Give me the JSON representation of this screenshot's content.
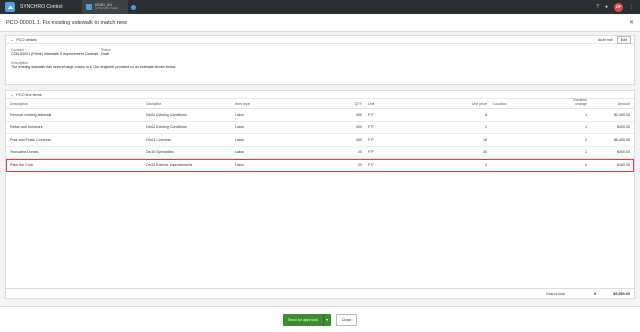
{
  "app": {
    "title": "SYNCHRO Control",
    "project_line1": "DEMO_001",
    "project_line2": "SYNCHRO Dash",
    "avatar_initials": "DP"
  },
  "page": {
    "title": "PCO-00001.1: Fix existing sidewalk to match new"
  },
  "details": {
    "section_title": "PCO details",
    "audit_trail": "Audit trail",
    "edit_label": "Edit",
    "contract_label": "Contract",
    "contract_value": "CON-00001 (Prime) Interstate 5 improvement Contract",
    "status_label": "Status",
    "status_value": "Draft",
    "description_label": "Description",
    "description_value": "The existing sidewalk has several large cracks in it. Our engineer provided us an estimate shown below."
  },
  "line_items": {
    "section_title": "PCO line items",
    "headers": {
      "description": "Description",
      "discipline": "Discipline",
      "item_type": "Item type",
      "qty": "QTY",
      "unit": "Unit",
      "unit_price": "Unit price",
      "location": "Location",
      "duration_1": "Duration",
      "duration_2": "change",
      "amount": "Amount"
    },
    "rows": [
      {
        "description": "Remove existing sidewalk",
        "discipline": "Div02 Existing Conditions",
        "item_type": "Labor",
        "qty": "400",
        "unit": "FT²",
        "unit_price": "6",
        "location": "",
        "duration": "1",
        "amount": "$2,400.00"
      },
      {
        "description": "Rebar and formwork",
        "discipline": "Div02 Existing Conditions",
        "item_type": "Labor",
        "qty": "400",
        "unit": "FT²",
        "unit_price": "1",
        "location": "",
        "duration": "1",
        "amount": "$400.00"
      },
      {
        "description": "Pour and Finish Concrete",
        "discipline": "Div03 Concrete",
        "item_type": "Labor",
        "qty": "400",
        "unit": "FT²",
        "unit_price": "16",
        "location": "",
        "duration": "2",
        "amount": "$6,400.00"
      },
      {
        "description": "Truncated Domes",
        "discipline": "Div10 Specialties",
        "item_type": "Labor",
        "qty": "20",
        "unit": "FT²",
        "unit_price": "20",
        "location": "",
        "duration": "1",
        "amount": "$400.00"
      },
      {
        "description": "Paint the Curb",
        "discipline": "Div32 Exterior Improvements",
        "item_type": "Labor",
        "qty": "20",
        "unit": "FT²",
        "unit_price": "4",
        "location": "",
        "duration": "0",
        "amount": "$180.00"
      }
    ],
    "grand_total_label": "Grand total",
    "grand_total_qty": "5",
    "grand_total_amount": "$9,980.00"
  },
  "footer": {
    "send_label": "Send for approval",
    "close_label": "Close"
  }
}
